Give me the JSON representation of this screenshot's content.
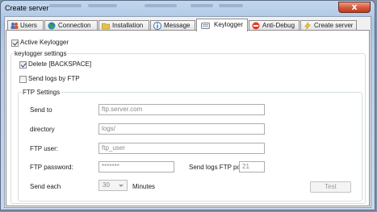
{
  "window": {
    "title": "Create server",
    "close_glyph": "x",
    "icons": {
      "close": "close-icon"
    }
  },
  "tabs": [
    {
      "label": "Users",
      "icon": "users-icon"
    },
    {
      "label": "Connection",
      "icon": "globe-icon"
    },
    {
      "label": "Installation",
      "icon": "folder-icon"
    },
    {
      "label": "Message",
      "icon": "info-icon"
    },
    {
      "label": "Keylogger",
      "icon": "keyboard-icon",
      "active": true
    },
    {
      "label": "Anti-Debug",
      "icon": "no-entry-icon"
    },
    {
      "label": "Create server",
      "icon": "lightning-icon"
    }
  ],
  "keylogger": {
    "active_label": "Active Keylogger",
    "active_checked": true,
    "settings_legend": "keylogger settings",
    "delete_label": "Delete [BACKSPACE]",
    "delete_checked": true,
    "send_ftp_label": "Send logs by FTP",
    "send_ftp_checked": false
  },
  "ftp": {
    "legend": "FTP Settings",
    "send_to_label": "Send to",
    "send_to_value": "ftp.server.com",
    "directory_label": "directory",
    "directory_value": "logs/",
    "user_label": "FTP user:",
    "user_value": "ftp_user",
    "password_label": "FTP password:",
    "password_value": "*******",
    "port_label": "Send logs FTP por",
    "port_value": "21",
    "send_each_label": "Send each",
    "send_each_value": "30",
    "minutes_label": "Minutes",
    "test_label": "Test"
  },
  "colors": {
    "window_frame": "#b9cde7",
    "close_button": "#c9482a",
    "checkmark": "#2b3a66"
  }
}
